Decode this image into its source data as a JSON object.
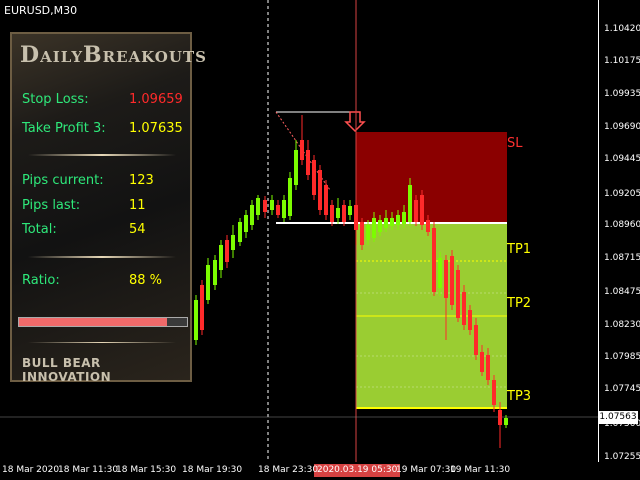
{
  "chart": {
    "symbol": "EURUSD,M30",
    "price_ticks": [
      "1.10420",
      "1.10175",
      "1.09935",
      "1.09690",
      "1.09445",
      "1.09205",
      "1.08960",
      "1.08715",
      "1.08475",
      "1.08230",
      "1.07985",
      "1.07745",
      "1.07500",
      "1.07255"
    ],
    "current_price": "1.07563",
    "time_ticks": [
      "18 Mar 2020",
      "18 Mar 11:30",
      "18 Mar 15:30",
      "18 Mar 19:30",
      "18 Mar 23:30",
      "19 Mar 07:30",
      "19 Mar 11:30"
    ],
    "current_time": "2020.03.19 05:30",
    "levels": {
      "sl": "SL",
      "tp1": "TP1",
      "tp2": "TP2",
      "tp3": "TP3"
    }
  },
  "colors": {
    "bull": "#7cfc00",
    "bear": "#ff2a2a",
    "sl_zone": "#8b0000",
    "tp_zone": "#9acd32"
  },
  "panel": {
    "logo_daily": "Daily",
    "logo_breakouts": "Breakouts",
    "stop_loss_label": "Stop Loss:",
    "stop_loss_value": "1.09659",
    "take_profit_label": "Take Profit 3:",
    "take_profit_value": "1.07635",
    "pips_current_label": "Pips current:",
    "pips_current_value": "123",
    "pips_last_label": "Pips last:",
    "pips_last_value": "11",
    "total_label": "Total:",
    "total_value": "54",
    "ratio_label": "Ratio:",
    "ratio_value": "88 %",
    "ratio_fraction": 0.88,
    "brand": "BULL BEAR INNOVATION"
  }
}
